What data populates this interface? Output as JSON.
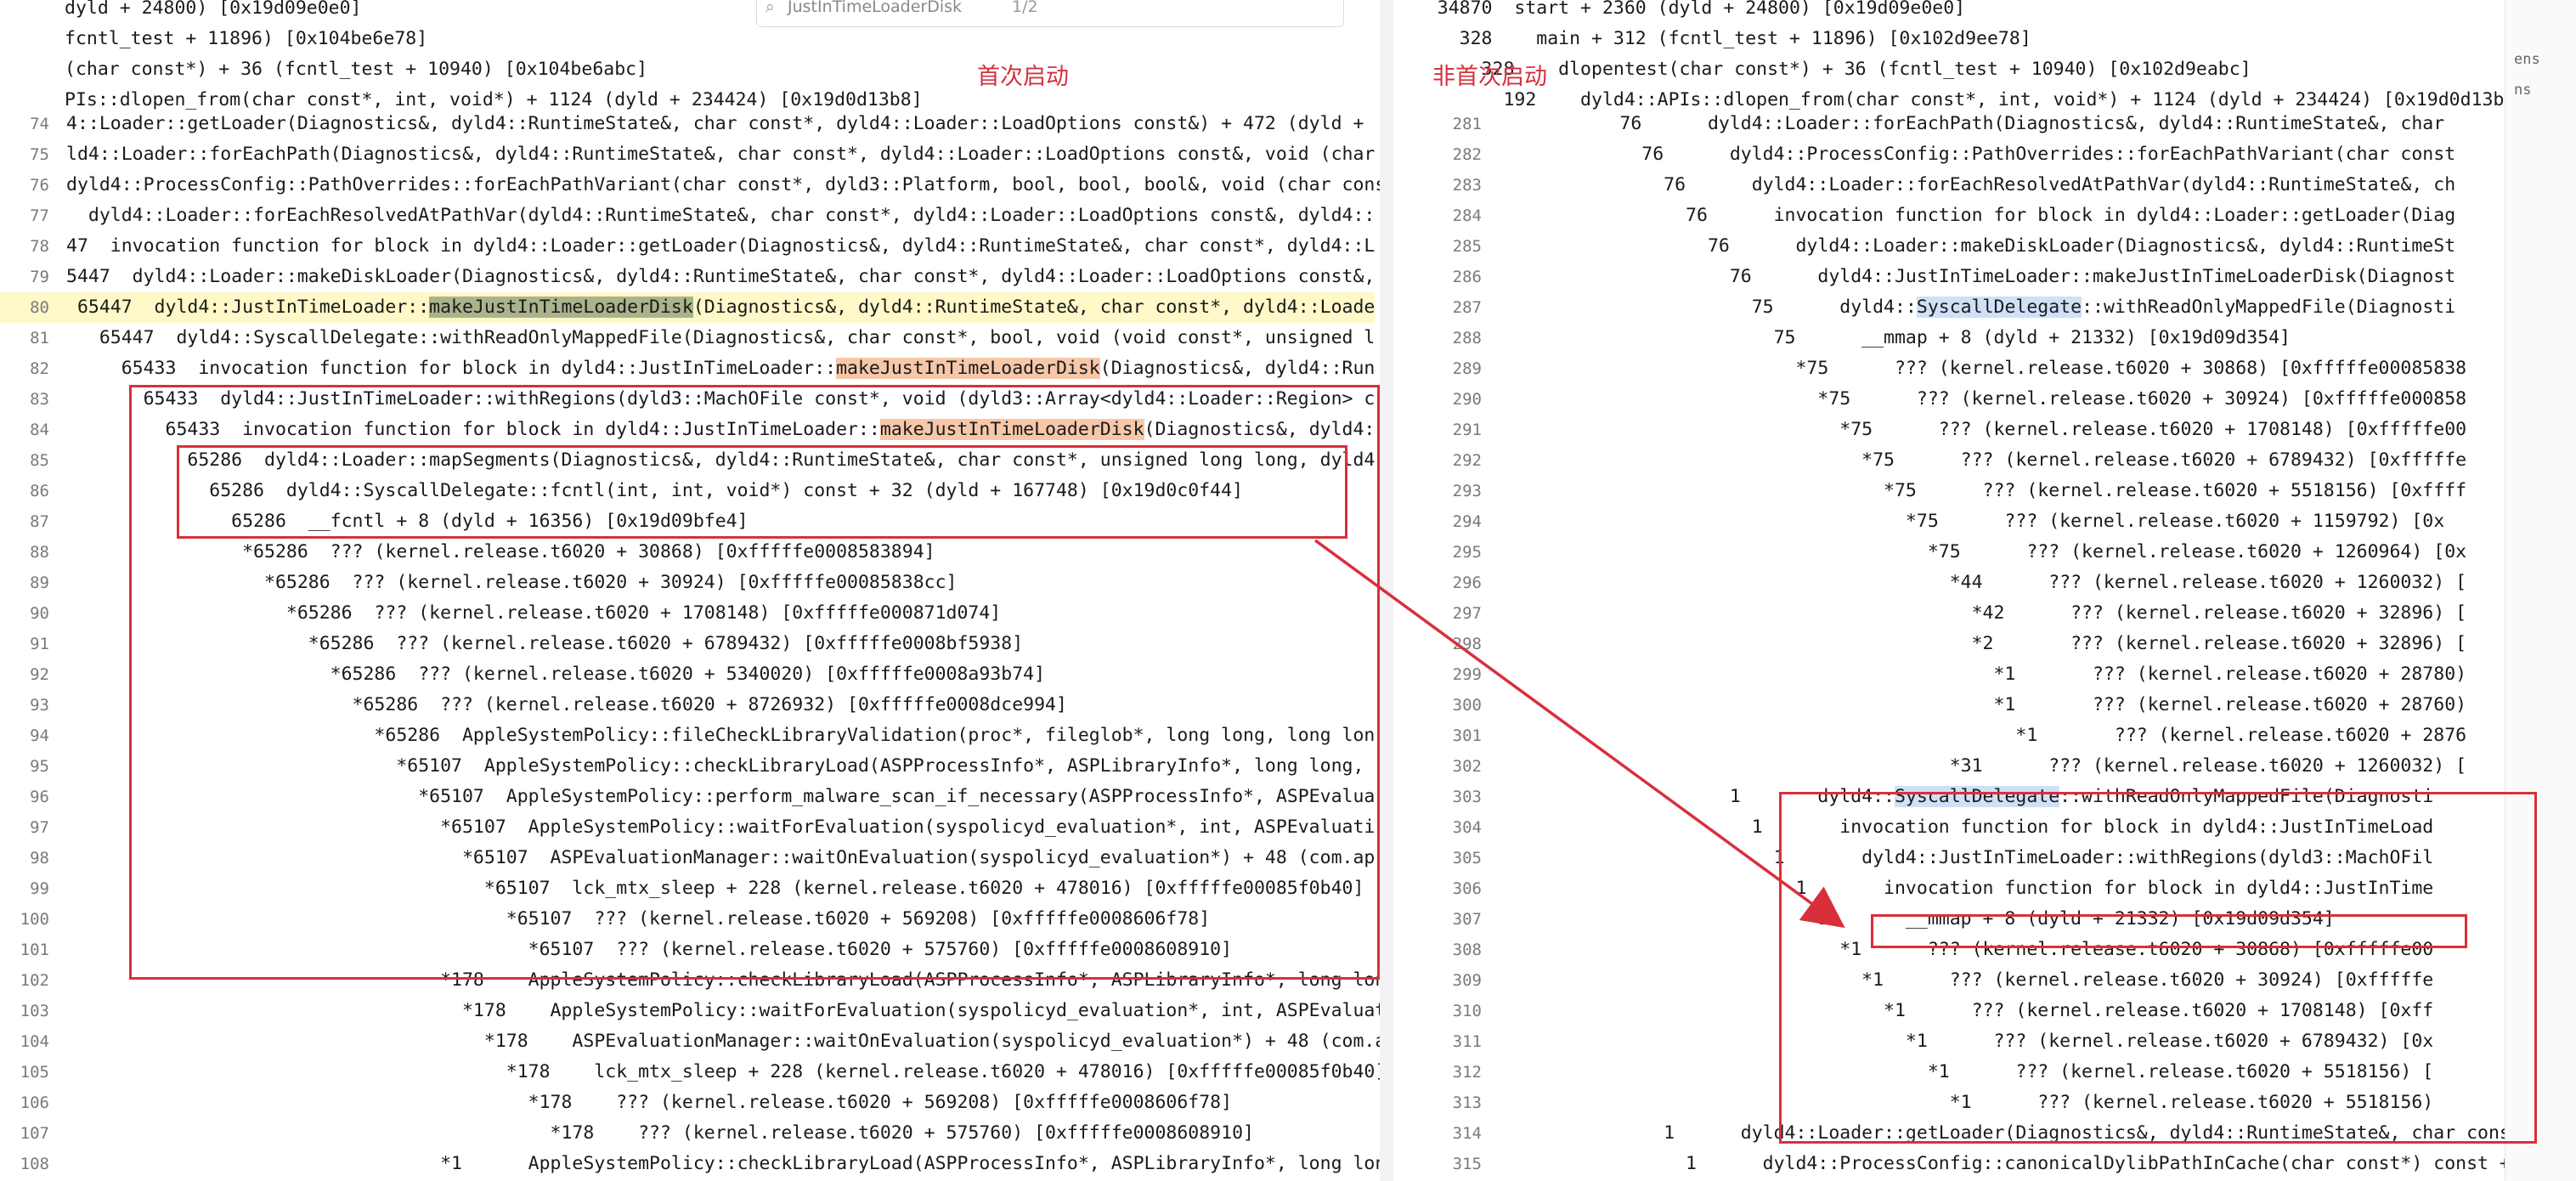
{
  "search": {
    "query": "JustInTimeLoaderDisk",
    "count": "1/2"
  },
  "labels": {
    "left": "首次启动",
    "right": "非首次启动"
  },
  "colors": {
    "annotation": "#d8303b",
    "highlight_row": "#fff8c8",
    "sym_olive": "#aab48c",
    "sym_orange": "#f6c7a8",
    "sym_blue": "#cfe0f7"
  },
  "left": {
    "header": [
      "dyld + 24800) [0x19d09e0e0]",
      "fcntl_test + 11896) [0x104be6e78]",
      "(char const*) + 36 (fcntl_test + 10940) [0x104be6abc]",
      "PIs::dlopen_from(char const*, int, void*) + 1124 (dyld + 234424) [0x19d0d13b8]"
    ],
    "lines": [
      {
        "n": "74",
        "t": "4::Loader::getLoader(Diagnostics&, dyld4::RuntimeState&, char const*, dyld4::Loader::LoadOptions const&) + 472 (dyld +"
      },
      {
        "n": "75",
        "t": "ld4::Loader::forEachPath(Diagnostics&, dyld4::RuntimeState&, char const*, dyld4::Loader::LoadOptions const&, void (char"
      },
      {
        "n": "76",
        "t": "dyld4::ProcessConfig::PathOverrides::forEachPathVariant(char const*, dyld3::Platform, bool, bool, bool&, void (char cons"
      },
      {
        "n": "77",
        "t": "  dyld4::Loader::forEachResolvedAtPathVar(dyld4::RuntimeState&, char const*, dyld4::Loader::LoadOptions const&, dyld4::"
      },
      {
        "n": "78",
        "t": "47  invocation function for block in dyld4::Loader::getLoader(Diagnostics&, dyld4::RuntimeState&, char const*, dyld4::L"
      },
      {
        "n": "79",
        "t": "5447  dyld4::Loader::makeDiskLoader(Diagnostics&, dyld4::RuntimeState&, char const*, dyld4::Loader::LoadOptions const&,"
      },
      {
        "n": "80",
        "pre": " 65447  dyld4::JustInTimeLoader::",
        "sym": "makeJustInTimeLoaderDisk",
        "post": "(Diagnostics&, dyld4::RuntimeState&, char const*, dyld4::Loade",
        "hl": "olive"
      },
      {
        "n": "81",
        "t": "   65447  dyld4::SyscallDelegate::withReadOnlyMappedFile(Diagnostics&, char const*, bool, void (void const*, unsigned l"
      },
      {
        "n": "82",
        "pre": "     65433  invocation function for block in dyld4::JustInTimeLoader::",
        "sym": "makeJustInTimeLoaderDisk",
        "post": "(Diagnostics&, dyld4::Run",
        "hl": "orange"
      },
      {
        "n": "83",
        "t": "       65433  dyld4::JustInTimeLoader::withRegions(dyld3::MachOFile const*, void (dyld3::Array<dyld4::Loader::Region> c"
      },
      {
        "n": "84",
        "pre": "         65433  invocation function for block in dyld4::JustInTimeLoader::",
        "sym": "makeJustInTimeLoaderDisk",
        "post": "(Diagnostics&, dyld4:",
        "hl": "orange"
      },
      {
        "n": "85",
        "t": "           65286  dyld4::Loader::mapSegments(Diagnostics&, dyld4::RuntimeState&, char const*, unsigned long long, dyld4"
      },
      {
        "n": "86",
        "t": "             65286  dyld4::SyscallDelegate::fcntl(int, int, void*) const + 32 (dyld + 167748) [0x19d0c0f44]"
      },
      {
        "n": "87",
        "t": "               65286  __fcntl + 8 (dyld + 16356) [0x19d09bfe4]"
      },
      {
        "n": "88",
        "t": "                *65286  ??? (kernel.release.t6020 + 30868) [0xfffffe0008583894]"
      },
      {
        "n": "89",
        "t": "                  *65286  ??? (kernel.release.t6020 + 30924) [0xfffffe00085838cc]"
      },
      {
        "n": "90",
        "t": "                    *65286  ??? (kernel.release.t6020 + 1708148) [0xfffffe000871d074]"
      },
      {
        "n": "91",
        "t": "                      *65286  ??? (kernel.release.t6020 + 6789432) [0xfffffe0008bf5938]"
      },
      {
        "n": "92",
        "t": "                        *65286  ??? (kernel.release.t6020 + 5340020) [0xfffffe0008a93b74]"
      },
      {
        "n": "93",
        "t": "                          *65286  ??? (kernel.release.t6020 + 8726932) [0xfffffe0008dce994]"
      },
      {
        "n": "94",
        "t": "                            *65286  AppleSystemPolicy::fileCheckLibraryValidation(proc*, fileglob*, long long, long lon"
      },
      {
        "n": "95",
        "t": "                              *65107  AppleSystemPolicy::checkLibraryLoad(ASPProcessInfo*, ASPLibraryInfo*, long long,"
      },
      {
        "n": "96",
        "t": "                                *65107  AppleSystemPolicy::perform_malware_scan_if_necessary(ASPProcessInfo*, ASPEvalua"
      },
      {
        "n": "97",
        "t": "                                  *65107  AppleSystemPolicy::waitForEvaluation(syspolicyd_evaluation*, int, ASPEvaluati"
      },
      {
        "n": "98",
        "t": "                                    *65107  ASPEvaluationManager::waitOnEvaluation(syspolicyd_evaluation*) + 48 (com.ap"
      },
      {
        "n": "99",
        "t": "                                      *65107  lck_mtx_sleep + 228 (kernel.release.t6020 + 478016) [0xfffffe00085f0b40]"
      },
      {
        "n": "100",
        "t": "                                        *65107  ??? (kernel.release.t6020 + 569208) [0xfffffe0008606f78]"
      },
      {
        "n": "101",
        "t": "                                          *65107  ??? (kernel.release.t6020 + 575760) [0xfffffe0008608910]"
      },
      {
        "n": "102",
        "t": "                                  *178    AppleSystemPolicy::checkLibraryLoad(ASPProcessInfo*, ASPLibraryInfo*, long long,"
      },
      {
        "n": "103",
        "t": "                                    *178    AppleSystemPolicy::waitForEvaluation(syspolicyd_evaluation*, int, ASPEvaluati"
      },
      {
        "n": "104",
        "t": "                                      *178    ASPEvaluationManager::waitOnEvaluation(syspolicyd_evaluation*) + 48 (com.appl"
      },
      {
        "n": "105",
        "t": "                                        *178    lck_mtx_sleep + 228 (kernel.release.t6020 + 478016) [0xfffffe00085f0b40]"
      },
      {
        "n": "106",
        "t": "                                          *178    ??? (kernel.release.t6020 + 569208) [0xfffffe0008606f78]"
      },
      {
        "n": "107",
        "t": "                                            *178    ??? (kernel.release.t6020 + 575760) [0xfffffe0008608910]"
      },
      {
        "n": "108",
        "t": "                                  *1      AppleSystemPolicy::checkLibraryLoad(ASPProcessInfo*, ASPLibraryInfo*, long long,"
      }
    ]
  },
  "right": {
    "header": [
      "    34870  start + 2360 (dyld + 24800) [0x19d09e0e0]",
      "      328    main + 312 (fcntl_test + 11896) [0x102d9ee78]",
      "        328    dlopentest(char const*) + 36 (fcntl_test + 10940) [0x102d9eabc]",
      "          192    dyld4::APIs::dlopen_from(char const*, int, void*) + 1124 (dyld + 234424) [0x19d0d13b8]"
    ],
    "lines": [
      {
        "n": "281",
        "t": "           76      dyld4::Loader::forEachPath(Diagnostics&, dyld4::RuntimeState&, char"
      },
      {
        "n": "282",
        "t": "             76      dyld4::ProcessConfig::PathOverrides::forEachPathVariant(char const"
      },
      {
        "n": "283",
        "t": "               76      dyld4::Loader::forEachResolvedAtPathVar(dyld4::RuntimeState&, ch"
      },
      {
        "n": "284",
        "t": "                 76      invocation function for block in dyld4::Loader::getLoader(Diag"
      },
      {
        "n": "285",
        "t": "                   76      dyld4::Loader::makeDiskLoader(Diagnostics&, dyld4::RuntimeSt"
      },
      {
        "n": "286",
        "t": "                     76      dyld4::JustInTimeLoader::makeJustInTimeLoaderDisk(Diagnost"
      },
      {
        "n": "287",
        "pre": "                       75      dyld4::",
        "sym": "SyscallDelegate",
        "post": "::withReadOnlyMappedFile(Diagnosti",
        "hl": "blue"
      },
      {
        "n": "288",
        "t": "                         75      __mmap + 8 (dyld + 21332) [0x19d09d354]"
      },
      {
        "n": "289",
        "t": "                           *75      ??? (kernel.release.t6020 + 30868) [0xfffffe00085838"
      },
      {
        "n": "290",
        "t": "                             *75      ??? (kernel.release.t6020 + 30924) [0xfffffe000858"
      },
      {
        "n": "291",
        "t": "                               *75      ??? (kernel.release.t6020 + 1708148) [0xfffffe00"
      },
      {
        "n": "292",
        "t": "                                 *75      ??? (kernel.release.t6020 + 6789432) [0xfffffe"
      },
      {
        "n": "293",
        "t": "                                   *75      ??? (kernel.release.t6020 + 5518156) [0xffff"
      },
      {
        "n": "294",
        "t": "                                     *75      ??? (kernel.release.t6020 + 1159792) [0x"
      },
      {
        "n": "295",
        "t": "                                       *75      ??? (kernel.release.t6020 + 1260964) [0x"
      },
      {
        "n": "296",
        "t": "                                         *44      ??? (kernel.release.t6020 + 1260032) ["
      },
      {
        "n": "297",
        "t": "                                           *42      ??? (kernel.release.t6020 + 32896) ["
      },
      {
        "n": "298",
        "t": "                                           *2       ??? (kernel.release.t6020 + 32896) ["
      },
      {
        "n": "299",
        "t": "                                             *1       ??? (kernel.release.t6020 + 28780)"
      },
      {
        "n": "300",
        "t": "                                             *1       ??? (kernel.release.t6020 + 28760)"
      },
      {
        "n": "301",
        "t": "                                               *1       ??? (kernel.release.t6020 + 2876"
      },
      {
        "n": "302",
        "t": "                                         *31      ??? (kernel.release.t6020 + 1260032) ["
      },
      {
        "n": "303",
        "pre": "                     1       dyld4::",
        "sym": "SyscallDelegate",
        "post": "::withReadOnlyMappedFile(Diagnosti",
        "hl": "blue"
      },
      {
        "n": "304",
        "t": "                       1       invocation function for block in dyld4::JustInTimeLoad"
      },
      {
        "n": "305",
        "t": "                         1       dyld4::JustInTimeLoader::withRegions(dyld3::MachOFil"
      },
      {
        "n": "306",
        "t": "                           1       invocation function for block in dyld4::JustInTime"
      },
      {
        "n": "307",
        "t": "                             1       __mmap + 8 (dyld + 21332) [0x19d09d354]"
      },
      {
        "n": "308",
        "t": "                               *1      ??? (kernel.release.t6020 + 30868) [0xfffffe00"
      },
      {
        "n": "309",
        "t": "                                 *1      ??? (kernel.release.t6020 + 30924) [0xfffffe"
      },
      {
        "n": "310",
        "t": "                                   *1      ??? (kernel.release.t6020 + 1708148) [0xff"
      },
      {
        "n": "311",
        "t": "                                     *1      ??? (kernel.release.t6020 + 6789432) [0x"
      },
      {
        "n": "312",
        "t": "                                       *1      ??? (kernel.release.t6020 + 5518156) ["
      },
      {
        "n": "313",
        "t": "                                         *1      ??? (kernel.release.t6020 + 5518156)"
      },
      {
        "n": "314",
        "t": "               1      dyld4::Loader::getLoader(Diagnostics&, dyld4::RuntimeState&, char cons"
      },
      {
        "n": "315",
        "t": "                 1      dyld4::ProcessConfig::canonicalDylibPathInCache(char const*) const +"
      }
    ]
  },
  "edge_fragments": [
    "ens",
    "ns"
  ]
}
